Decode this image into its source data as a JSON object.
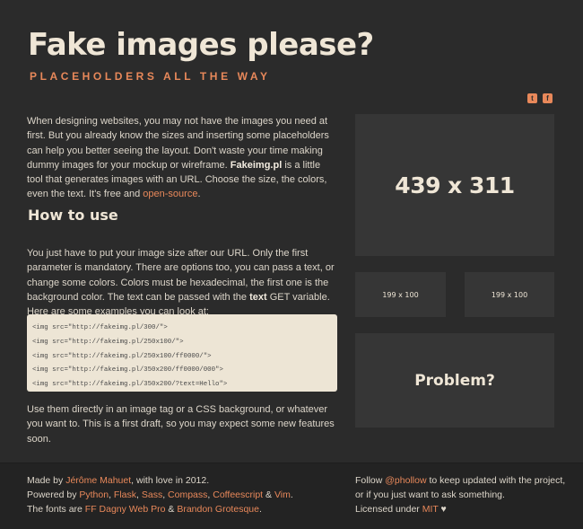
{
  "header": {
    "title": "Fake images please?",
    "tagline": "PLACEHOLDERS ALL THE WAY"
  },
  "social": {
    "twitter_icon": "twitter-icon",
    "twitter_glyph": "t",
    "facebook_icon": "facebook-icon",
    "facebook_glyph": "f"
  },
  "intro": {
    "text_1": "When designing websites, you may not have the images you need at first. But you already know the sizes and inserting some placeholders can help you better seeing the layout. Don't waste your time making dummy images for your mockup or wireframe. ",
    "brand": "Fakeimg.pl",
    "text_2": " is a little tool that generates images with an URL. Choose the size, the colors, even the text. It's free and ",
    "link_open_source": "open-source",
    "text_3": "."
  },
  "howto": {
    "heading": "How to use",
    "text_1": "You just have to put your image size after our URL. Only the first parameter is mandatory. There are options too, you can pass a text, or change some colors. Colors must be hexadecimal, the first one is the background color. The text can be passed with the ",
    "text_bold": "text",
    "text_2": " GET variable. Here are some examples you can look at:",
    "code_lines": [
      "<img src=\"http://fakeimg.pl/300/\">",
      "<img src=\"http://fakeimg.pl/250x100/\">",
      "<img src=\"http://fakeimg.pl/250x100/ff0000/\">",
      "<img src=\"http://fakeimg.pl/350x200/ff0000/000\">",
      "<img src=\"http://fakeimg.pl/350x200/?text=Hello\">"
    ],
    "outro": "Use them directly in an image tag or a CSS background, or whatever you want to. This is a first draft, so you may expect some new features soon."
  },
  "placeholders": {
    "big": "439 x 311",
    "small_1": "199 x 100",
    "small_2": "199 x 100",
    "problem": "Problem?"
  },
  "footer": {
    "left": {
      "made_by_prefix": "Made by ",
      "author": "Jérôme Mahuet",
      "made_by_suffix": ", with love in 2012.",
      "powered_prefix": "Powered by ",
      "tech_1": "Python",
      "sep_1": ", ",
      "tech_2": "Flask",
      "sep_2": ", ",
      "tech_3": "Sass",
      "sep_3": ", ",
      "tech_4": "Compass",
      "sep_4": ", ",
      "tech_5": "Coffeescript",
      "sep_5": " & ",
      "tech_6": "Vim",
      "sep_6": ".",
      "fonts_prefix": "The fonts are ",
      "font_1": "FF Dagny Web Pro",
      "fonts_sep": " & ",
      "font_2": "Brandon Grotesque",
      "fonts_suffix": "."
    },
    "right": {
      "follow_prefix": "Follow ",
      "handle": "@phollow",
      "follow_suffix": " to keep updated with the project,",
      "line_2": "or if you just want to ask something.",
      "license_prefix": "Licensed under ",
      "license": "MIT",
      "heart": " ♥"
    }
  },
  "colors": {
    "background": "#2b2b2b",
    "accent": "#e8885a",
    "placeholder": "#363636",
    "code_bg": "#ede5d5"
  }
}
